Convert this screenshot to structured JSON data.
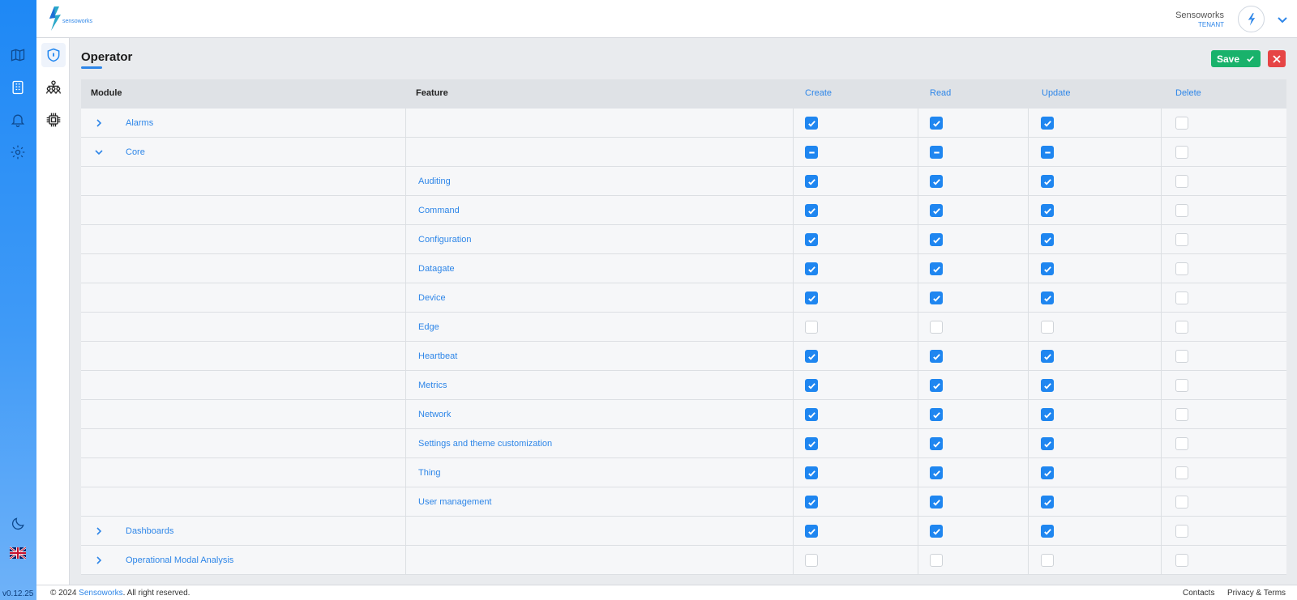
{
  "app": {
    "version": "v0.12.25",
    "brand_color": "#2e86e8"
  },
  "header": {
    "user_name": "Sensoworks",
    "user_role": "TENANT"
  },
  "page": {
    "title": "Operator",
    "save_label": "Save"
  },
  "table": {
    "columns": {
      "module": "Module",
      "feature": "Feature",
      "create": "Create",
      "read": "Read",
      "update": "Update",
      "delete": "Delete"
    },
    "rows": [
      {
        "type": "module",
        "expanded": false,
        "module": "Alarms",
        "feature": "",
        "create": "checked",
        "read": "checked",
        "update": "checked",
        "delete": "unchecked"
      },
      {
        "type": "module",
        "expanded": true,
        "module": "Core",
        "feature": "",
        "create": "mixed",
        "read": "mixed",
        "update": "mixed",
        "delete": "unchecked"
      },
      {
        "type": "feature",
        "module": "",
        "feature": "Auditing",
        "create": "checked",
        "read": "checked",
        "update": "checked",
        "delete": "unchecked"
      },
      {
        "type": "feature",
        "module": "",
        "feature": "Command",
        "create": "checked",
        "read": "checked",
        "update": "checked",
        "delete": "unchecked"
      },
      {
        "type": "feature",
        "module": "",
        "feature": "Configuration",
        "create": "checked",
        "read": "checked",
        "update": "checked",
        "delete": "unchecked"
      },
      {
        "type": "feature",
        "module": "",
        "feature": "Datagate",
        "create": "checked",
        "read": "checked",
        "update": "checked",
        "delete": "unchecked"
      },
      {
        "type": "feature",
        "module": "",
        "feature": "Device",
        "create": "checked",
        "read": "checked",
        "update": "checked",
        "delete": "unchecked"
      },
      {
        "type": "feature",
        "module": "",
        "feature": "Edge",
        "create": "unchecked",
        "read": "unchecked",
        "update": "unchecked",
        "delete": "unchecked"
      },
      {
        "type": "feature",
        "module": "",
        "feature": "Heartbeat",
        "create": "checked",
        "read": "checked",
        "update": "checked",
        "delete": "unchecked"
      },
      {
        "type": "feature",
        "module": "",
        "feature": "Metrics",
        "create": "checked",
        "read": "checked",
        "update": "checked",
        "delete": "unchecked"
      },
      {
        "type": "feature",
        "module": "",
        "feature": "Network",
        "create": "checked",
        "read": "checked",
        "update": "checked",
        "delete": "unchecked"
      },
      {
        "type": "feature",
        "module": "",
        "feature": "Settings and theme customization",
        "create": "checked",
        "read": "checked",
        "update": "checked",
        "delete": "unchecked"
      },
      {
        "type": "feature",
        "module": "",
        "feature": "Thing",
        "create": "checked",
        "read": "checked",
        "update": "checked",
        "delete": "unchecked"
      },
      {
        "type": "feature",
        "module": "",
        "feature": "User management",
        "create": "checked",
        "read": "checked",
        "update": "checked",
        "delete": "unchecked"
      },
      {
        "type": "module",
        "expanded": false,
        "module": "Dashboards",
        "feature": "",
        "create": "checked",
        "read": "checked",
        "update": "checked",
        "delete": "unchecked"
      },
      {
        "type": "module",
        "expanded": false,
        "module": "Operational Modal Analysis",
        "feature": "",
        "create": "unchecked",
        "read": "unchecked",
        "update": "unchecked",
        "delete": "unchecked"
      }
    ]
  },
  "footer": {
    "copyright_prefix": "© 2024 ",
    "company": "Sensoworks",
    "copyright_suffix": ". All right reserved.",
    "contacts": "Contacts",
    "privacy": "Privacy & Terms"
  },
  "icons": {
    "sidebar": [
      "map-icon",
      "building-icon",
      "bell-icon",
      "gear-icon",
      "moon-icon",
      "uk-flag-icon"
    ],
    "subbar": [
      "shield-icon",
      "users-icon",
      "chip-icon"
    ]
  }
}
